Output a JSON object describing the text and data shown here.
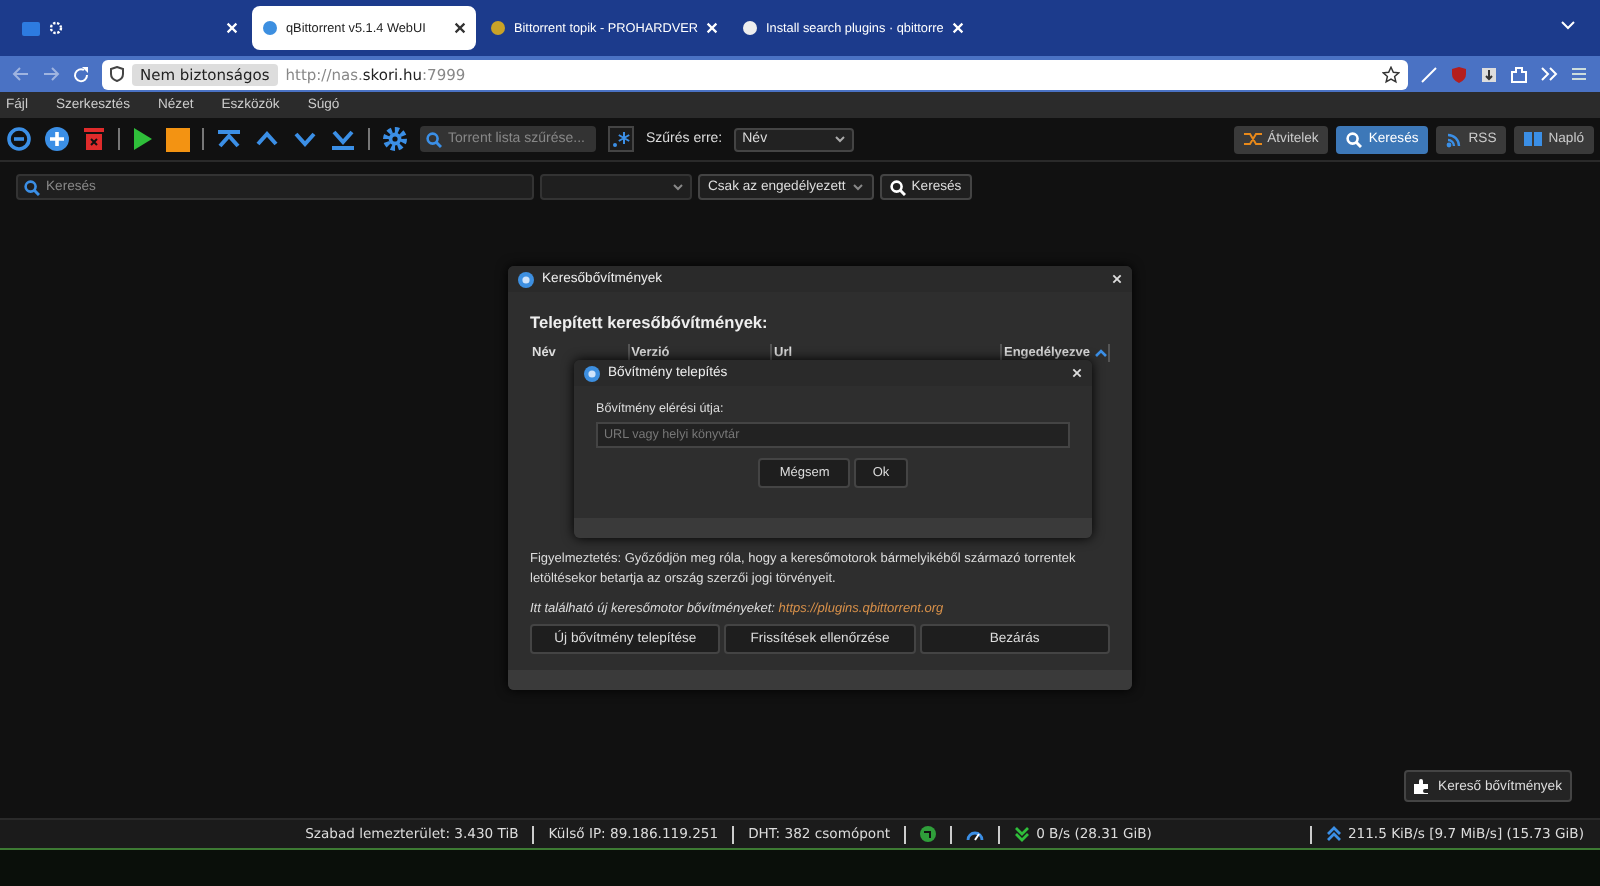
{
  "browser": {
    "tabs": [
      {
        "label": "qBittorrent v5.1.4 WebUI",
        "selected": true
      },
      {
        "label": "Bittorrent topik - PROHARDVER",
        "selected": false
      },
      {
        "label": "Install search plugins · qbittorre",
        "selected": false
      }
    ],
    "security": "Nem biztonságos",
    "url": "http://nas.**skori.hu**:7999"
  },
  "menu": [
    "Fájl",
    "Szerkesztés",
    "Nézet",
    "Eszközök",
    "Súgó"
  ],
  "toolbar": {
    "filter_placeholder": "Torrent lista szűrése...",
    "filter_by_label": "Szűrés erre:",
    "filter_by_value": "Név",
    "views": [
      {
        "label": "Átvitelek",
        "selected": false
      },
      {
        "label": "Keresés",
        "selected": true
      },
      {
        "label": "RSS",
        "selected": false
      },
      {
        "label": "Napló",
        "selected": false
      }
    ]
  },
  "search": {
    "placeholder": "Keresés",
    "plugin_filter": "Csak az engedélyezett",
    "button": "Keresés"
  },
  "plugins_dialog": {
    "title": "Keresőbővítmények",
    "heading": "Telepített keresőbővítmények:",
    "columns": [
      {
        "label": "Név",
        "sorted": false
      },
      {
        "label": "Verzió",
        "sorted": false
      },
      {
        "label": "Url",
        "sorted": false
      },
      {
        "label": "Engedélyezve",
        "sorted": true
      }
    ],
    "warning": "Figyelmeztetés: Győződjön meg róla, hogy a keresőmotorok bármelyikéből származó torrentek letöltésekor betartja az ország szerzői jogi törvényeit.",
    "hint": "Itt található új keresőmotor bővítményeket:",
    "link": "https://plugins.qbittorrent.org",
    "buttons": [
      "Új bővítmény telepítése",
      "Frissítések ellenőrzése",
      "Bezárás"
    ]
  },
  "install_dialog": {
    "title": "Bővítmény telepítés",
    "label": "Bővítmény elérési útja:",
    "placeholder": "URL vagy helyi könyvtár",
    "buttons": [
      "Mégsem",
      "Ok"
    ]
  },
  "plugins_button": "Kereső bővítmények",
  "status_bar": {
    "free_space": "Szabad lemezterület: 3.430 TiB",
    "external_ip": "Külső IP: 89.186.119.251",
    "dht": "DHT: 382 csomópont",
    "download": "0 B/s (28.31 GiB)",
    "upload": "211.5 KiB/s [9.7 MiB/s] (15.73 GiB)"
  }
}
